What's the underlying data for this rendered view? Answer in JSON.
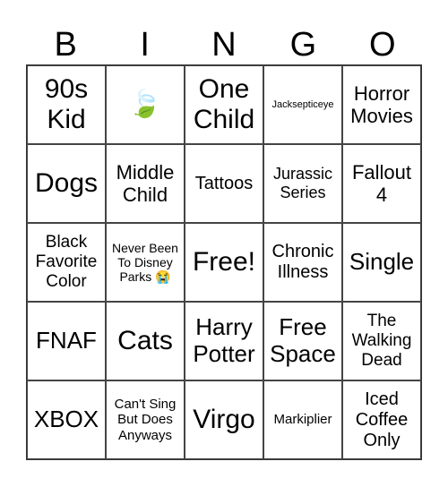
{
  "header": [
    "B",
    "I",
    "N",
    "G",
    "O"
  ],
  "cells": [
    {
      "text": "90s Kid",
      "size": 30
    },
    {
      "text": "🍃",
      "size": 30
    },
    {
      "text": "One Child",
      "size": 30
    },
    {
      "text": "Jacksepticeye",
      "size": 11
    },
    {
      "text": "Horror Movies",
      "size": 22
    },
    {
      "text": "Dogs",
      "size": 30
    },
    {
      "text": "Middle Child",
      "size": 22
    },
    {
      "text": "Tattoos",
      "size": 20
    },
    {
      "text": "Jurassic Series",
      "size": 18
    },
    {
      "text": "Fallout 4",
      "size": 22
    },
    {
      "text": "Black Favorite Color",
      "size": 19
    },
    {
      "text": "Never Been To Disney Parks 😭",
      "size": 14
    },
    {
      "text": "Free!",
      "size": 30
    },
    {
      "text": "Chronic Illness",
      "size": 20
    },
    {
      "text": "Single",
      "size": 26
    },
    {
      "text": "FNAF",
      "size": 26
    },
    {
      "text": "Cats",
      "size": 30
    },
    {
      "text": "Harry Potter",
      "size": 26
    },
    {
      "text": "Free Space",
      "size": 26
    },
    {
      "text": "The Walking Dead",
      "size": 19
    },
    {
      "text": "XBOX",
      "size": 26
    },
    {
      "text": "Can't Sing But Does Anyways",
      "size": 15
    },
    {
      "text": "Virgo",
      "size": 30
    },
    {
      "text": "Markiplier",
      "size": 15
    },
    {
      "text": "Iced Coffee Only",
      "size": 20
    }
  ]
}
